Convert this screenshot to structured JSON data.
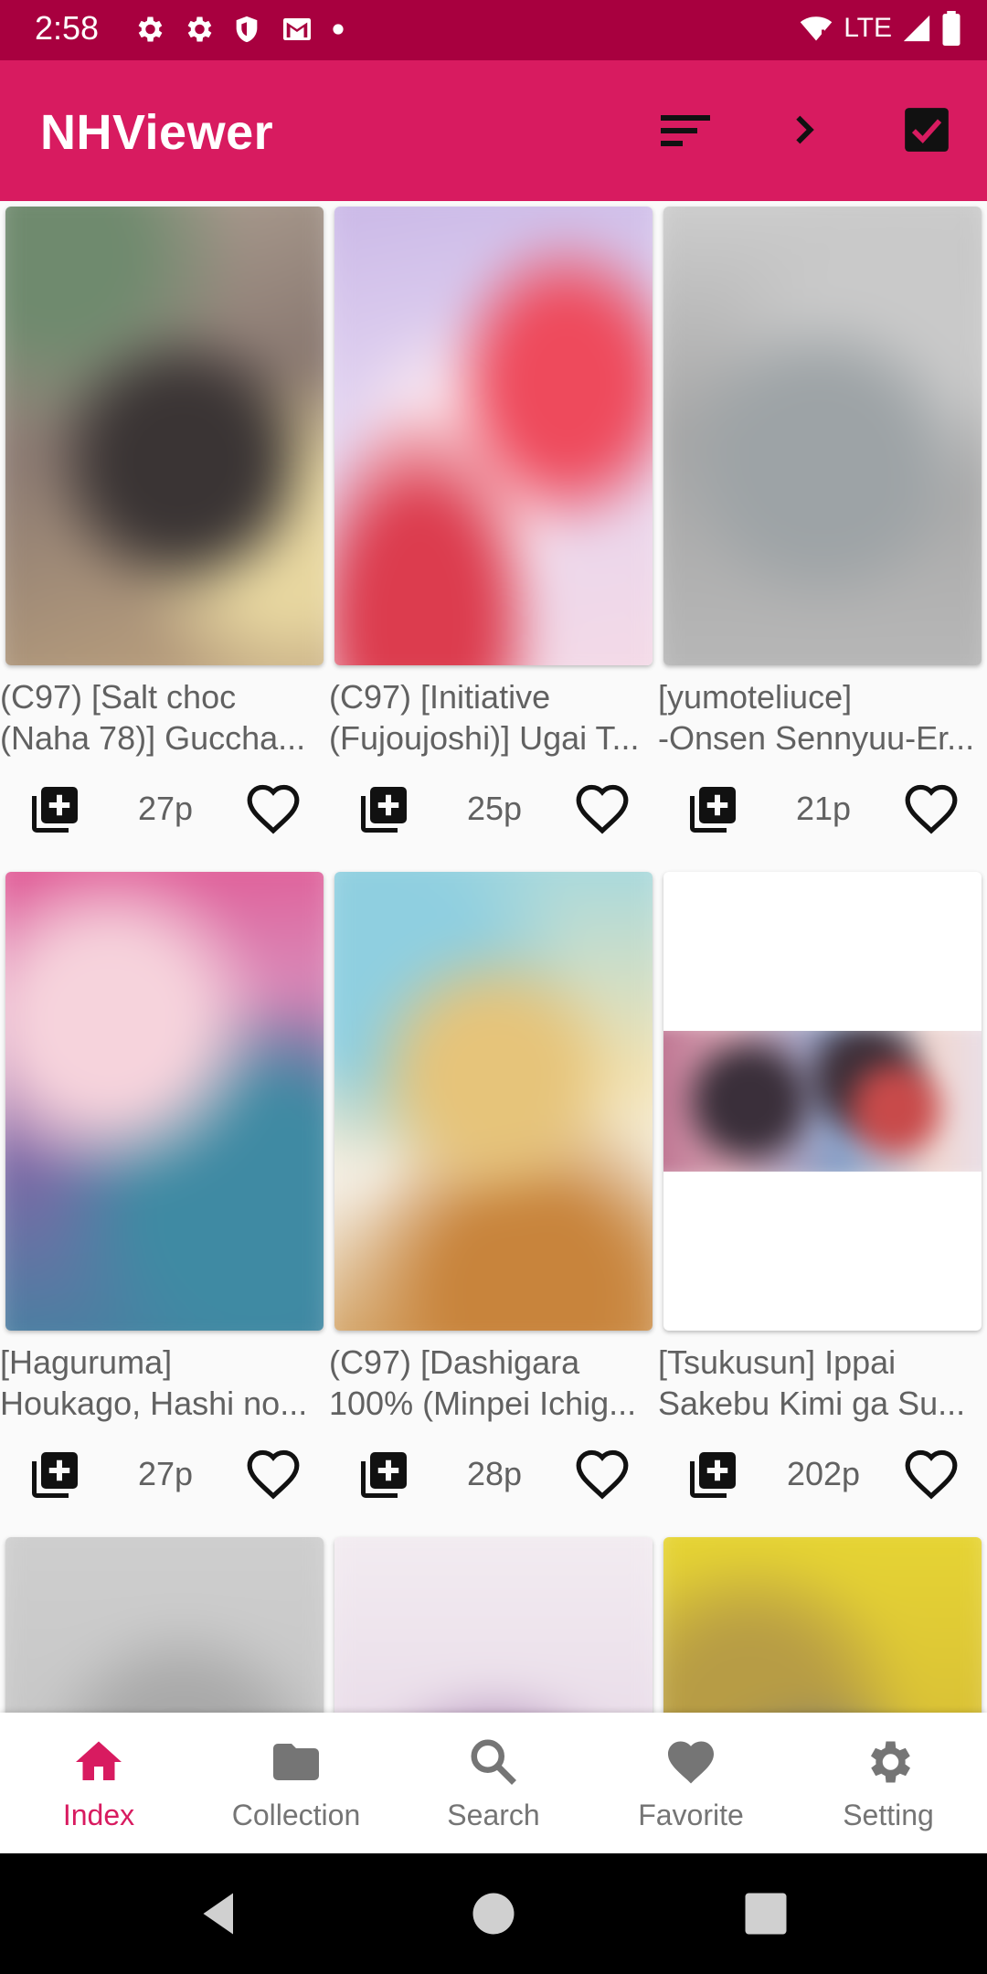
{
  "status_bar": {
    "time": "2:58",
    "network": "LTE"
  },
  "app_bar": {
    "title": "NHViewer",
    "sort_icon": "sort-icon",
    "next_icon": "chevron-right-icon",
    "select_icon": "checkbox-icon"
  },
  "grid": {
    "items": [
      {
        "title_line1": "(C97) [Salt choc",
        "title_line2": "(Naha 78)] Guccha...",
        "pages": "27p"
      },
      {
        "title_line1": "(C97) [Initiative",
        "title_line2": "(Fujoujoshi)] Ugai T...",
        "pages": "25p"
      },
      {
        "title_line1": "[yumoteliuce]",
        "title_line2": "-Onsen Sennyuu-Er...",
        "pages": "21p"
      },
      {
        "title_line1": "[Hagurumа]",
        "title_line2": "Houkago, Hashi no...",
        "pages": "27p"
      },
      {
        "title_line1": "(C97) [Dashigara",
        "title_line2": "100% (Minpei Ichig...",
        "pages": "28p"
      },
      {
        "title_line1": "[Tsukusun] Ippai",
        "title_line2": "Sakebu Kimi ga Su...",
        "pages": "202p"
      }
    ]
  },
  "bottom_nav": {
    "items": [
      {
        "label": "Index",
        "icon": "home-icon",
        "active": true
      },
      {
        "label": "Collection",
        "icon": "folder-icon",
        "active": false
      },
      {
        "label": "Search",
        "icon": "search-icon",
        "active": false
      },
      {
        "label": "Favorite",
        "icon": "heart-icon",
        "active": false
      },
      {
        "label": "Setting",
        "icon": "gear-icon",
        "active": false
      }
    ]
  },
  "colors": {
    "primary": "#d81b60",
    "primary_dark": "#a8003f",
    "text_secondary": "#616161"
  }
}
